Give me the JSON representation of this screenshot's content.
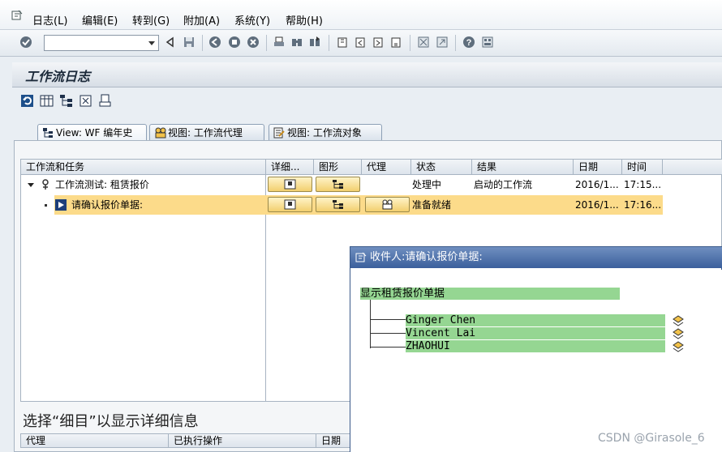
{
  "menubar": {
    "items": [
      "日志(L)",
      "编辑(E)",
      "转到(G)",
      "附加(A)",
      "系统(Y)",
      "帮助(H)"
    ]
  },
  "toolbar": {
    "command_field_value": "",
    "icons": [
      "enter-icon",
      "back-icon",
      "save-icon",
      "back-nav-icon",
      "exit-icon",
      "cancel-icon",
      "print-icon",
      "find-icon",
      "find-next-icon",
      "first-page-icon",
      "prev-page-icon",
      "next-page-icon",
      "last-page-icon",
      "new-session-icon",
      "shortcut-icon",
      "help-icon",
      "layout-icon"
    ]
  },
  "page": {
    "title": "工作流日志"
  },
  "tabs": [
    {
      "label": "View: WF 编年史"
    },
    {
      "label": "视图: 工作流代理"
    },
    {
      "label": "视图: 工作流对象"
    }
  ],
  "table": {
    "columns": [
      "工作流和任务",
      "详细...",
      "图形",
      "代理",
      "状态",
      "结果",
      "日期",
      "时间"
    ],
    "rows": [
      {
        "task": "工作流测试: 租赁报价",
        "status": "处理中",
        "result": "启动的工作流",
        "date": "2016/1...",
        "time": "17:15..."
      },
      {
        "task": "请确认报价单据:",
        "status": "准备就绪",
        "result": "",
        "date": "2016/1...",
        "time": "17:16..."
      }
    ]
  },
  "detail": {
    "title": "选择“细目”以显示详细信息",
    "columns": [
      "代理",
      "已执行操作",
      "日期"
    ]
  },
  "popup": {
    "title": "收件人:请确认报价单据:",
    "root": "显示租赁报价单据",
    "recipients": [
      "Ginger Chen",
      "Vincent Lai",
      "ZHAOHUI"
    ]
  },
  "watermark": "CSDN @Girasole_6",
  "colors": {
    "selected_row": "#fcdb8a",
    "tree_highlight": "#95d692",
    "popup_title": "#3b5f9c"
  }
}
